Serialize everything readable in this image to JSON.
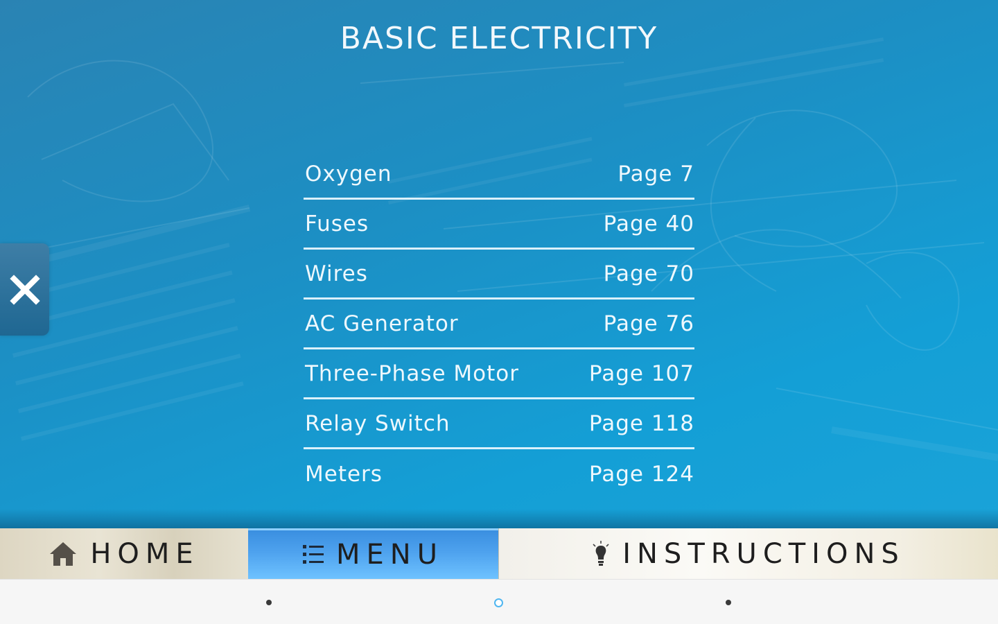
{
  "page": {
    "title": "BASIC ELECTRICITY"
  },
  "toc": {
    "items": [
      {
        "topic": "Oxygen",
        "page": "Page 7"
      },
      {
        "topic": "Fuses",
        "page": "Page 40"
      },
      {
        "topic": "Wires",
        "page": "Page 70"
      },
      {
        "topic": "AC Generator",
        "page": "Page 76"
      },
      {
        "topic": "Three-Phase Motor",
        "page": "Page 107"
      },
      {
        "topic": "Relay Switch",
        "page": "Page 118"
      },
      {
        "topic": "Meters",
        "page": "Page 124"
      }
    ]
  },
  "close_panel": {
    "icon": "close-icon"
  },
  "navbar": {
    "home": {
      "label": "HOME",
      "icon": "house-icon"
    },
    "menu": {
      "label": "MENU",
      "icon": "list-icon",
      "active": true
    },
    "instructions": {
      "label": "INSTRUCTIONS",
      "icon": "lightbulb-icon"
    }
  },
  "system_nav": {
    "back": "back-dot",
    "home": "home-ring",
    "recent": "recent-dot"
  },
  "colors": {
    "content_bg": "#1c8fc4",
    "text_light": "#eef8fd",
    "menu_active": "#4ea2ee",
    "close_tab": "#2d72a0"
  }
}
